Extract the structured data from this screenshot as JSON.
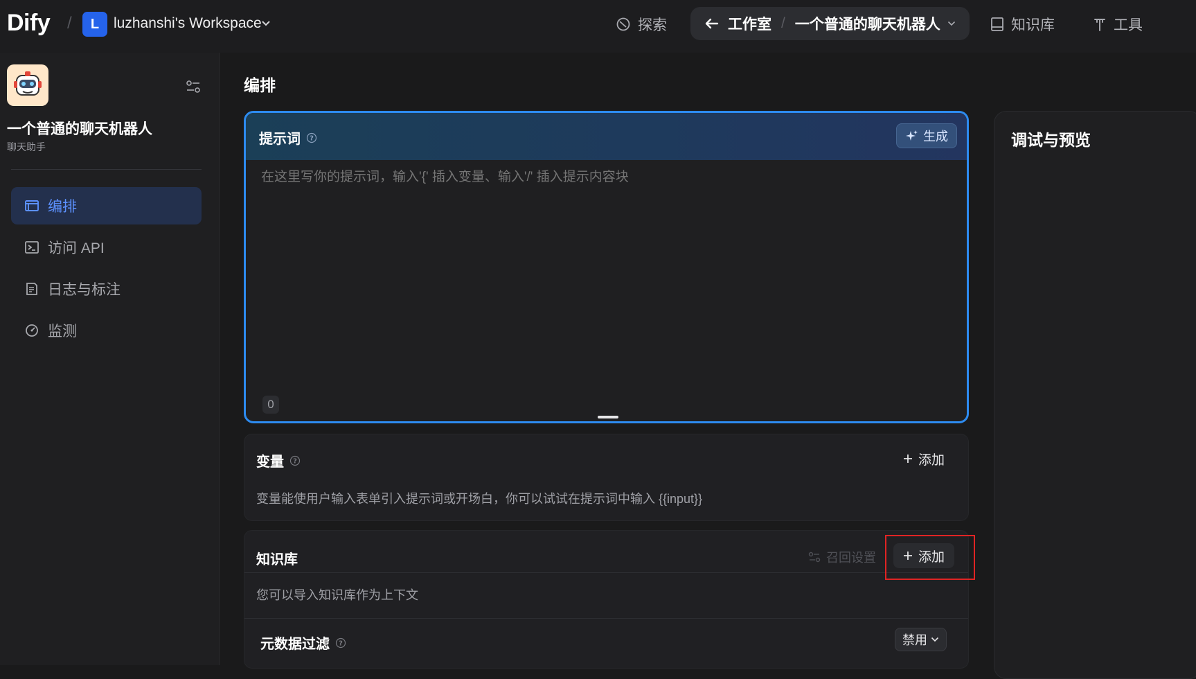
{
  "topbar": {
    "logo": "Dify",
    "workspace_initial": "L",
    "workspace_name": "luzhanshi's Workspace",
    "explore": "探索",
    "studio": "工作室",
    "current_app": "一个普通的聊天机器人",
    "knowledge": "知识库",
    "tools": "工具"
  },
  "sidebar": {
    "app_name": "一个普通的聊天机器人",
    "app_type": "聊天助手",
    "items": [
      {
        "label": "编排",
        "icon": "layout-icon",
        "active": true
      },
      {
        "label": "访问 API",
        "icon": "terminal-icon",
        "active": false
      },
      {
        "label": "日志与标注",
        "icon": "document-icon",
        "active": false
      },
      {
        "label": "监测",
        "icon": "dashboard-gauge-icon",
        "active": false
      }
    ]
  },
  "main": {
    "title": "编排",
    "prompt": {
      "label": "提示词",
      "generate_label": "生成",
      "placeholder": "在这里写你的提示词，输入'{' 插入变量、输入'/' 插入提示内容块",
      "value": "",
      "char_count": "0"
    },
    "variables": {
      "title": "变量",
      "add_label": "添加",
      "description": "变量能使用户输入表单引入提示词或开场白，你可以试试在提示词中输入 {{input}}"
    },
    "knowledge": {
      "title": "知识库",
      "recall_label": "召回设置",
      "add_label": "添加",
      "description": "您可以导入知识库作为上下文",
      "metadata_title": "元数据过滤",
      "metadata_value": "禁用"
    }
  },
  "debug": {
    "title": "调试与预览"
  },
  "colors": {
    "accent": "#2d8bf0",
    "active_menu_text": "#5c91ff",
    "highlight_box": "#e02424"
  }
}
